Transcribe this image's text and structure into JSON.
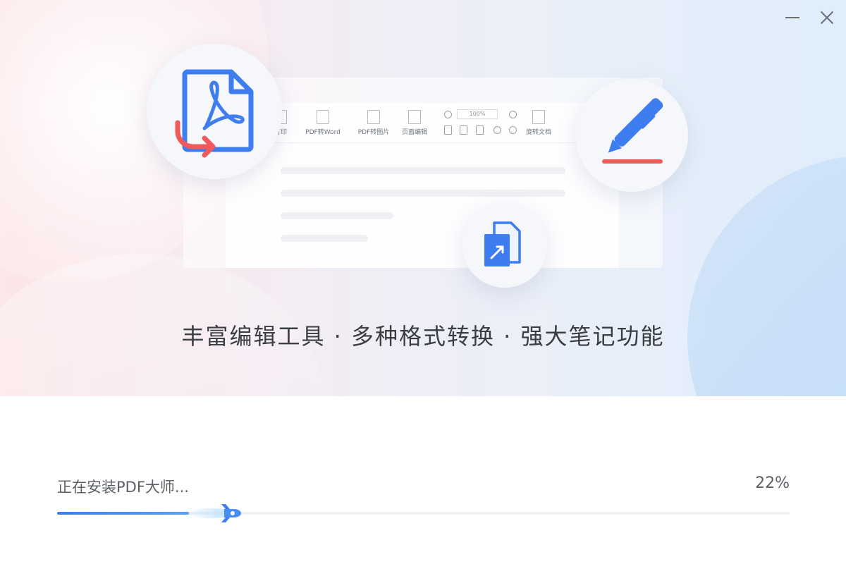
{
  "window": {
    "minimize_label": "",
    "close_label": ""
  },
  "hero": {
    "slogan": "丰富编辑工具 · 多种格式转换 · 强大笔记功能",
    "toolbar": {
      "items": [
        "打印",
        "PDF转Word",
        "PDF转图片",
        "页面编辑",
        "旋转文档"
      ],
      "zoom": "100%"
    },
    "icons": [
      "pdf-convert-icon",
      "pen-note-icon",
      "format-convert-icon"
    ]
  },
  "install": {
    "status_text": "正在安装PDF大师...",
    "percent_text": "22%",
    "progress": 0.22
  },
  "colors": {
    "accent_blue": "#3d7df0",
    "accent_red": "#f05a5a"
  }
}
